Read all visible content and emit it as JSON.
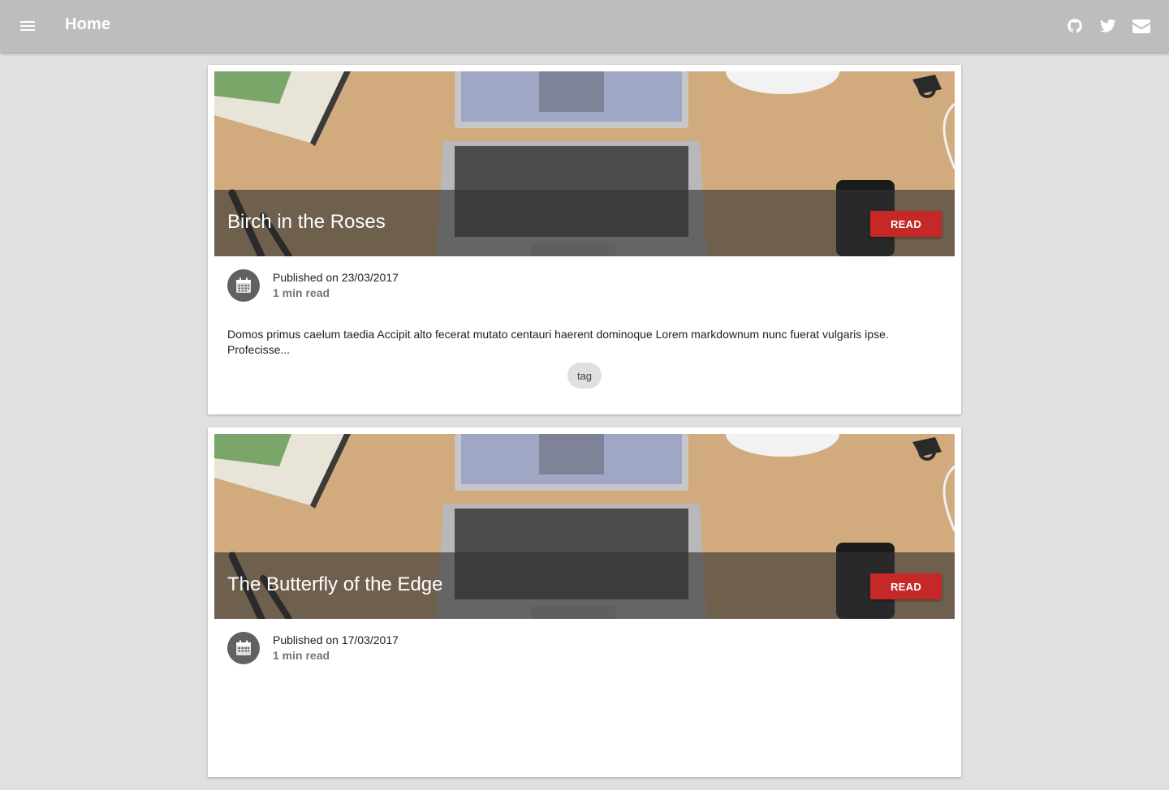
{
  "header": {
    "title": "Home",
    "menu_icon": "menu-icon",
    "social": [
      "github-icon",
      "twitter-icon",
      "mail-icon"
    ]
  },
  "colors": {
    "topbar": "#bdbdbd",
    "background": "#e0e0e0",
    "read_button": "#c62828",
    "avatar": "#616161"
  },
  "posts": [
    {
      "title": "Birch in the Roses",
      "read_label": "READ",
      "published": "Published on 23/03/2017",
      "read_time": "1 min read",
      "excerpt": "Domos primus caelum taedia Accipit alto fecerat mutato centauri haerent dominoque Lorem markdownum nunc fuerat vulgaris ipse. Profecisse...",
      "tag": "tag"
    },
    {
      "title": "The Butterfly of the Edge",
      "read_label": "READ",
      "published": "Published on 17/03/2017",
      "read_time": "1 min read",
      "excerpt": "",
      "tag": ""
    }
  ]
}
